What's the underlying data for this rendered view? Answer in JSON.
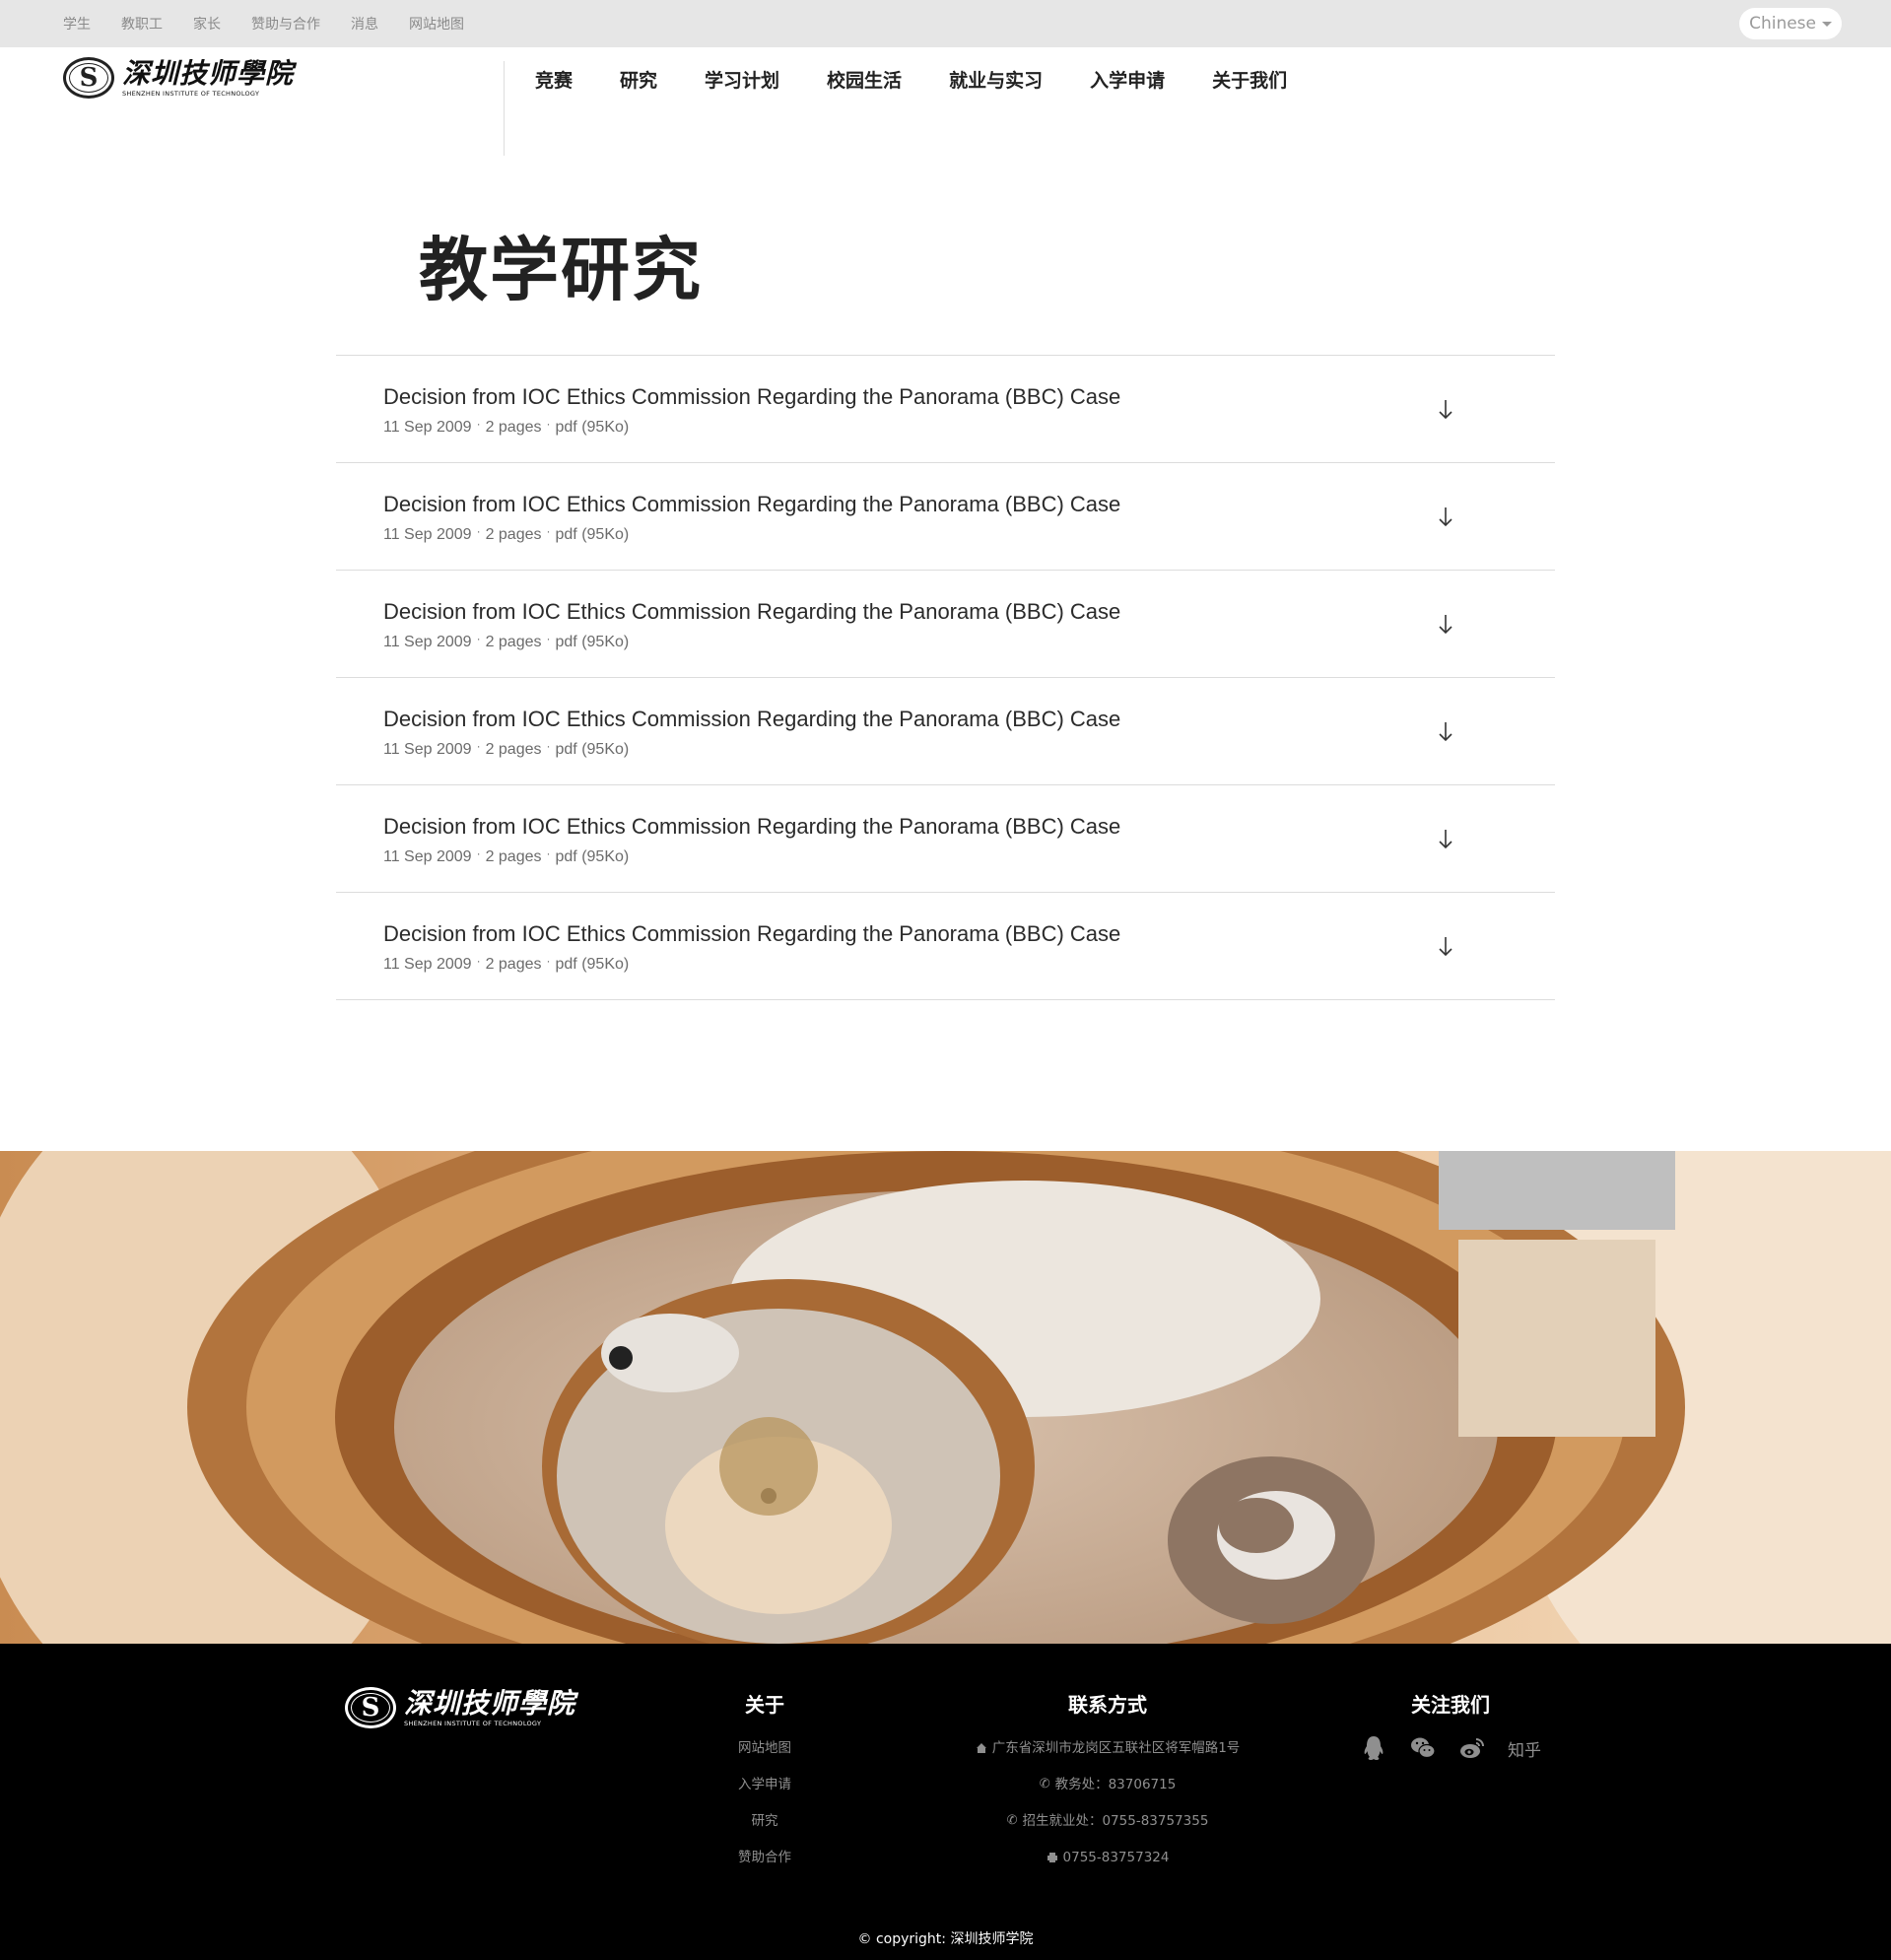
{
  "utility_nav": [
    "学生",
    "教职工",
    "家长",
    "赞助与合作",
    "消息",
    "网站地图"
  ],
  "language": {
    "selected": "Chinese"
  },
  "logo": {
    "cn": "深圳技师學院",
    "en": "SHENZHEN INSTITUTE OF TECHNOLOGY",
    "seal": "S"
  },
  "main_nav": [
    "竞赛",
    "研究",
    "学习计划",
    "校园生活",
    "就业与实习",
    "入学申请",
    "关于我们"
  ],
  "page_title": "教学研究",
  "documents": [
    {
      "title": "Decision from IOC Ethics Commission Regarding the Panorama (BBC) Case",
      "date": "11 Sep 2009",
      "pages": "2 pages",
      "format": "pdf (95Ko)"
    },
    {
      "title": "Decision from IOC Ethics Commission Regarding the Panorama (BBC) Case",
      "date": "11 Sep 2009",
      "pages": "2 pages",
      "format": "pdf (95Ko)"
    },
    {
      "title": "Decision from IOC Ethics Commission Regarding the Panorama (BBC) Case",
      "date": "11 Sep 2009",
      "pages": "2 pages",
      "format": "pdf (95Ko)"
    },
    {
      "title": "Decision from IOC Ethics Commission Regarding the Panorama (BBC) Case",
      "date": "11 Sep 2009",
      "pages": "2 pages",
      "format": "pdf (95Ko)"
    },
    {
      "title": "Decision from IOC Ethics Commission Regarding the Panorama (BBC) Case",
      "date": "11 Sep 2009",
      "pages": "2 pages",
      "format": "pdf (95Ko)"
    },
    {
      "title": "Decision from IOC Ethics Commission Regarding the Panorama (BBC) Case",
      "date": "11 Sep 2009",
      "pages": "2 pages",
      "format": "pdf (95Ko)"
    }
  ],
  "meta_separator": "·",
  "footer": {
    "about": {
      "heading": "关于",
      "links": [
        "网站地图",
        "入学申请",
        "研究",
        "赞助合作"
      ]
    },
    "contact": {
      "heading": "联系方式",
      "address": "广东省深圳市龙岗区五联社区将军帽路1号",
      "academic": "教务处：83706715",
      "admissions": "招生就业处：0755-83757355",
      "fax": "0755-83757324"
    },
    "follow": {
      "heading": "关注我们",
      "zhihu": "知乎",
      "icons": [
        "qq-icon",
        "wechat-icon",
        "weibo-icon"
      ]
    },
    "copyright": "© copyright: 深圳技师学院"
  }
}
